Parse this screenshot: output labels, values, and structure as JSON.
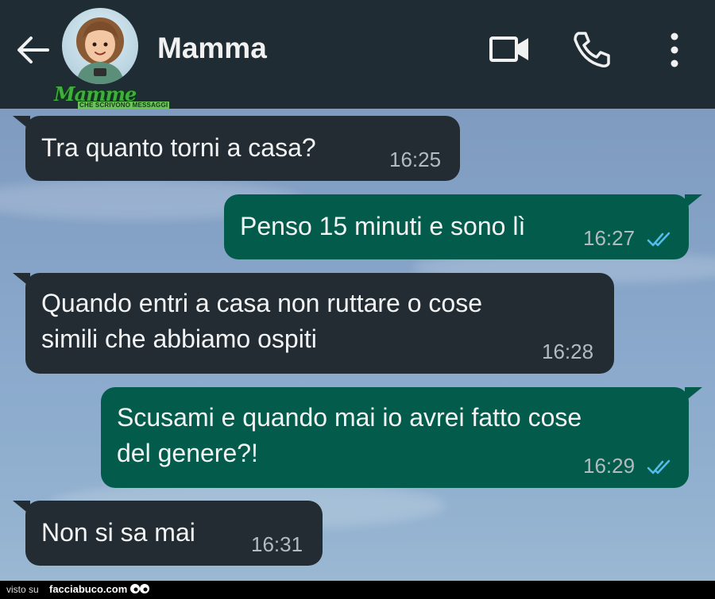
{
  "header": {
    "contact_name": "Mamma",
    "brand_title": "Mamme",
    "brand_subtitle": "CHE SCRIVONO MESSAGGI"
  },
  "messages": [
    {
      "direction": "in",
      "lines": [
        "Tra quanto torni a casa?"
      ],
      "time": "16:25",
      "read": false
    },
    {
      "direction": "out",
      "lines": [
        "Penso 15 minuti e sono lì"
      ],
      "time": "16:27",
      "read": true
    },
    {
      "direction": "in",
      "lines": [
        "Quando entri a casa non ruttare o cose",
        "simili che abbiamo ospiti"
      ],
      "time": "16:28",
      "read": false
    },
    {
      "direction": "out",
      "lines": [
        "Scusami e quando mai io avrei fatto cose",
        "del genere?!"
      ],
      "time": "16:29",
      "read": true
    },
    {
      "direction": "in",
      "lines": [
        "Non si sa mai"
      ],
      "time": "16:31",
      "read": false
    }
  ],
  "footer": {
    "visto_su": "visto su",
    "site": "facciabuco.com"
  },
  "colors": {
    "header_bg": "#1f2c33",
    "incoming_bubble": "#222c32",
    "outgoing_bubble": "#035c4b",
    "read_ticks": "#53bdeb"
  },
  "icons": [
    "back-arrow-icon",
    "video-call-icon",
    "phone-icon",
    "more-vertical-icon",
    "double-check-icon"
  ]
}
